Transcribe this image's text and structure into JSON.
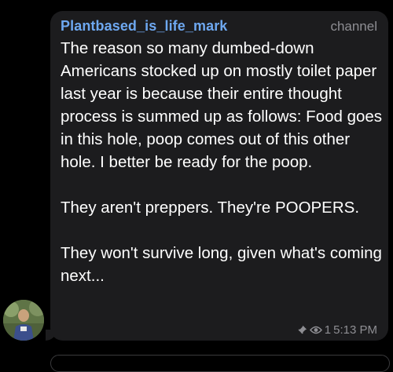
{
  "message": {
    "sender": "Plantbased_is_life_mark",
    "channel_label": "channel",
    "paragraphs": [
      "The reason so many dumbed-down Americans stocked up on mostly toilet paper last year is because their entire thought process is summed up as follows: Food goes in this hole, poop comes out of this other hole. I better be ready for the poop.",
      "They aren't preppers. They're POOPERS.",
      "They won't survive long, given what's coming next..."
    ],
    "views": "1",
    "time": "5:13 PM"
  },
  "icons": {
    "pin": "pin-icon",
    "views": "eye-icon"
  },
  "colors": {
    "background": "#000000",
    "bubble": "#1c1c1e",
    "sender": "#6ea8f0",
    "meta": "#8e8e93",
    "text": "#ffffff"
  }
}
